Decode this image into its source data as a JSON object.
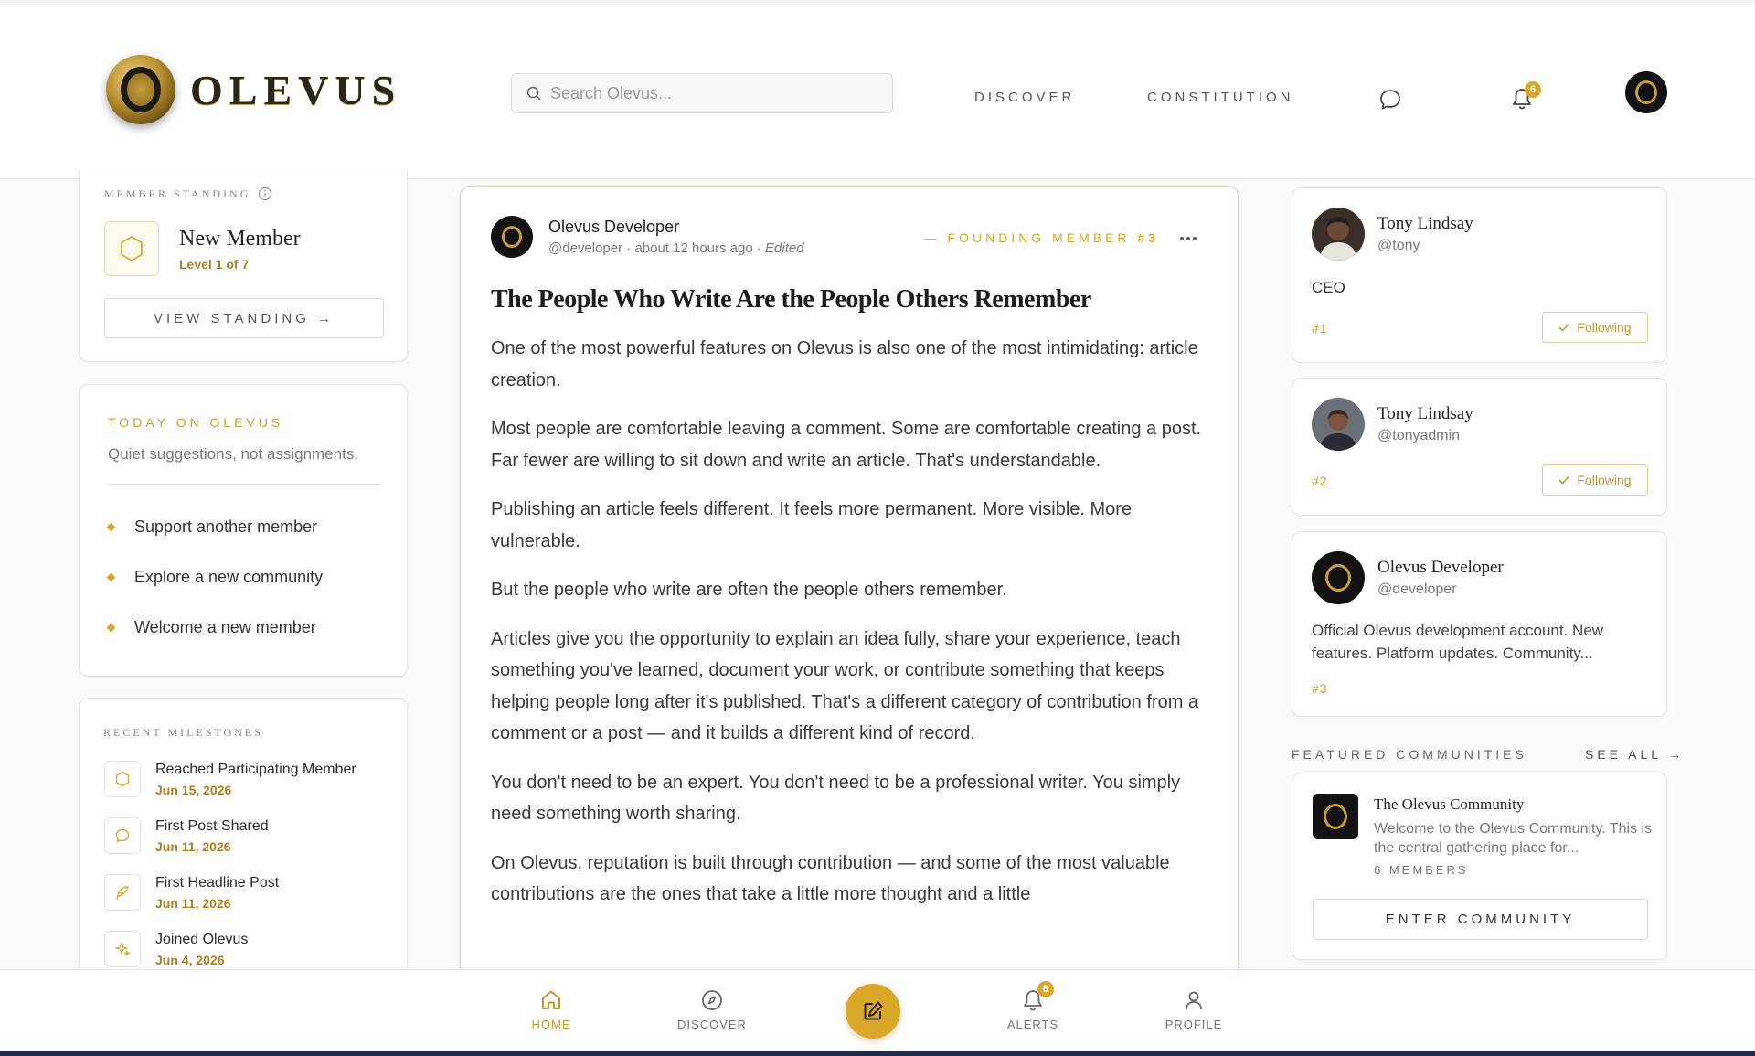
{
  "header": {
    "brand": "OLEVUS",
    "search_placeholder": "Search Olevus...",
    "nav": [
      "DISCOVER",
      "CONSTITUTION"
    ],
    "notification_count": "6"
  },
  "standing": {
    "label": "MEMBER STANDING",
    "title": "New Member",
    "level": "Level 1 of 7",
    "button": "VIEW STANDING →"
  },
  "today": {
    "label": "TODAY ON OLEVUS",
    "subtitle": "Quiet suggestions, not assignments.",
    "items": [
      "Support another member",
      "Explore a new community",
      "Welcome a new member"
    ]
  },
  "milestones": {
    "label": "RECENT MILESTONES",
    "items": [
      {
        "title": "Reached Participating Member",
        "date": "Jun 15, 2026",
        "icon": "hexagon-icon"
      },
      {
        "title": "First Post Shared",
        "date": "Jun 11, 2026",
        "icon": "chat-icon"
      },
      {
        "title": "First Headline Post",
        "date": "Jun 11, 2026",
        "icon": "feather-icon"
      },
      {
        "title": "Joined Olevus",
        "date": "Jun 4, 2026",
        "icon": "sparkle-icon"
      }
    ]
  },
  "post": {
    "author": "Olevus Developer",
    "meta": "@developer · about 12 hours ago · ",
    "edited": "Edited",
    "badge": "— FOUNDING MEMBER",
    "badge_number": "#3",
    "title": "The People Who Write Are the People Others Remember",
    "paragraphs": [
      "One of the most powerful features on Olevus is also one of the most intimidating: article creation.",
      "Most people are comfortable leaving a comment. Some are comfortable creating a post. Far fewer are willing to sit down and write an article. That's understandable.",
      "Publishing an article feels different. It feels more permanent. More visible. More vulnerable.",
      "But the people who write are often the people others remember.",
      "Articles give you the opportunity to explain an idea fully, share your experience, teach something you've learned, document your work, or contribute something that keeps helping people long after it's published. That's a different category of contribution from a comment or a post — and it builds a different kind of record.",
      "You don't need to be an expert. You don't need to be a professional writer. You simply need something worth sharing.",
      "On Olevus, reputation is built through contribution — and some of the most valuable contributions are the ones that take a little more thought and a little"
    ]
  },
  "people": [
    {
      "name": "Tony Lindsay",
      "handle": "@tony",
      "bio": "CEO",
      "rank": "#1",
      "action": "Following"
    },
    {
      "name": "Tony Lindsay",
      "handle": "@tonyadmin",
      "bio": "",
      "rank": "#2",
      "action": "Following"
    },
    {
      "name": "Olevus Developer",
      "handle": "@developer",
      "bio": "Official Olevus development account. New features. Platform updates. Community...",
      "rank": "#3",
      "action": ""
    }
  ],
  "featured": {
    "label": "FEATURED COMMUNITIES",
    "see_all": "SEE ALL →",
    "community": {
      "name": "The Olevus Community",
      "desc": "Welcome to the Olevus Community. This is the central gathering place for...",
      "members": "6 MEMBERS",
      "button": "ENTER COMMUNITY"
    }
  },
  "bottom_nav": {
    "home": "HOME",
    "discover": "DISCOVER",
    "alerts": "ALERTS",
    "profile": "PROFILE",
    "alerts_count": "6"
  },
  "colors": {
    "accent": "#d9a82a",
    "text": "#2b2b2b"
  }
}
